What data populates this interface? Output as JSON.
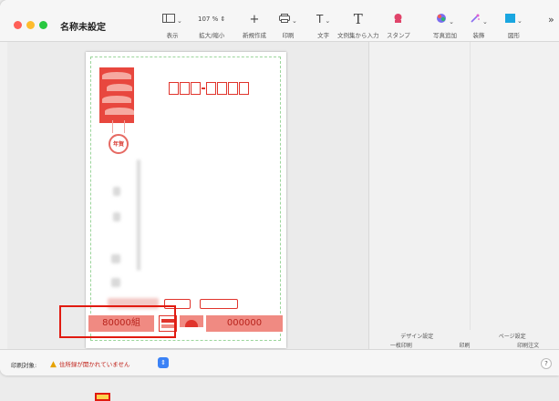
{
  "window": {
    "title": "名称未設定"
  },
  "toolbar": {
    "view": {
      "icon": "sidebar-icon",
      "label": "表示"
    },
    "zoom": {
      "value": "107 %",
      "label": "拡大/縮小"
    },
    "new": {
      "icon": "+",
      "label": "新規作成"
    },
    "print": {
      "icon": "printer-icon",
      "label": "印刷"
    },
    "text": {
      "icon": "T",
      "label": "文字"
    },
    "phrase": {
      "icon": "T",
      "label": "文例集から入力"
    },
    "stamp": {
      "icon": "stamp-icon",
      "label": "スタンプ"
    },
    "photo": {
      "icon": "photo-icon",
      "label": "写真追加"
    },
    "decor": {
      "icon": "magic-wand-icon",
      "label": "装飾"
    },
    "shape": {
      "icon": "square-icon",
      "label": "図形"
    },
    "more": {
      "icon": "»"
    }
  },
  "postcard": {
    "nenga": "年賀",
    "lottery_left": "80000組",
    "lottery_right": "000000"
  },
  "right_panel": {
    "row1": [
      "デザイン設定",
      "ページ設定"
    ],
    "row2": [
      "一枚印刷",
      "印刷",
      "印刷注文"
    ]
  },
  "statusbar": {
    "label": "印刷対象:",
    "warning": "住所録が開かれていません",
    "help": "?"
  },
  "colors": {
    "accent_red": "#e0342c",
    "highlight": "#e11a10",
    "select_blue": "#3b82f6"
  }
}
